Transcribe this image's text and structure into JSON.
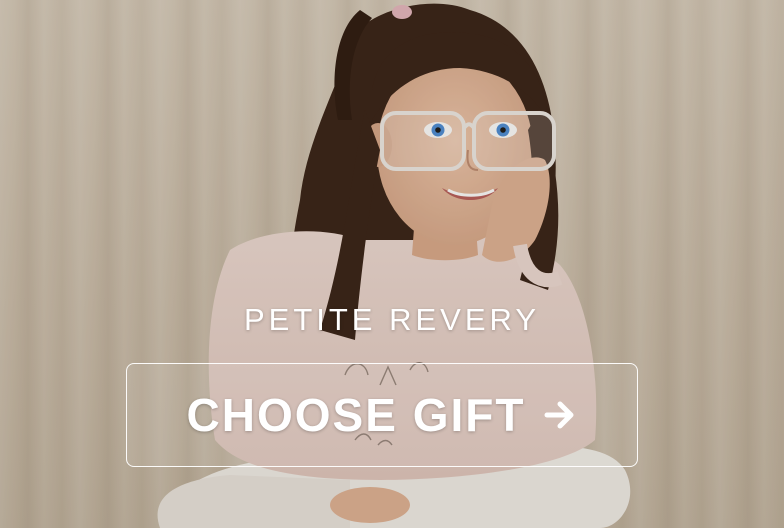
{
  "banner": {
    "brand": "PETITE REVERY",
    "cta_label": "CHOOSE GIFT",
    "cta_icon": "arrow-right-icon",
    "photo_subject": "girl-with-glasses-photo",
    "colors": {
      "text": "#ffffff",
      "backdrop": "#d2c5b2",
      "sweater": "#ead3cc",
      "hair": "#3a2418",
      "skin": "#e7bda1",
      "glasses": "#f1ece8",
      "pants": "#f3efea"
    }
  }
}
